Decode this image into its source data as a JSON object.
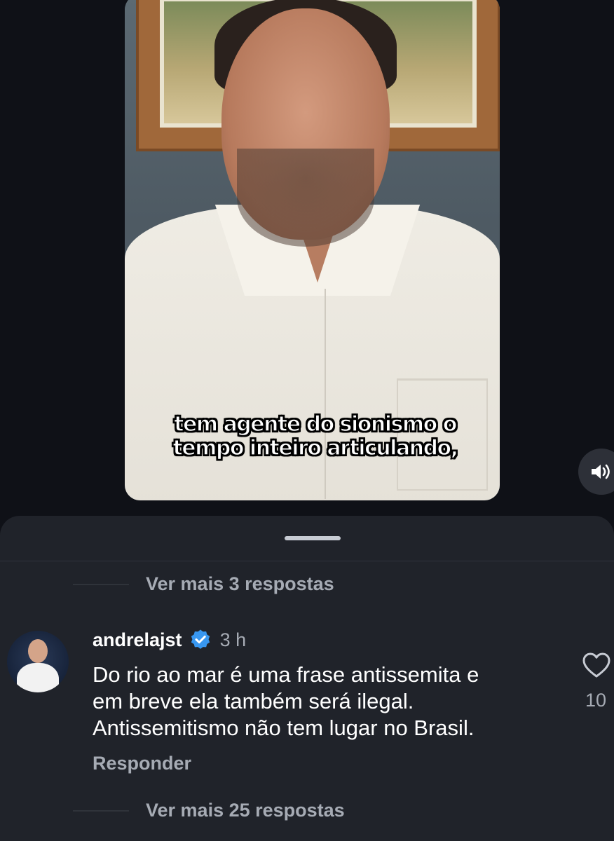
{
  "video": {
    "subtitle_line1": "tem agente do sionismo o",
    "subtitle_line2": "tempo inteiro articulando,"
  },
  "icons": {
    "mute": "speaker-volume-icon",
    "verified": "verified-badge-icon",
    "like": "heart-icon"
  },
  "comments": {
    "more_replies_top": "Ver mais 3 respostas",
    "comment": {
      "username": "andrelajst",
      "time": "3 h",
      "text_line1": "Do rio ao mar é uma frase antissemita e",
      "text_line2": "em breve ela também será ilegal.",
      "text_line3": "Antissemitismo não tem lugar no Brasil.",
      "reply_label": "Responder",
      "like_count": "10"
    },
    "more_replies_bottom": "Ver mais 25 respostas"
  },
  "colors": {
    "background": "#0f1117",
    "sheet": "#20232a",
    "verified_blue": "#3897f0",
    "muted_text": "#a6abb4"
  }
}
